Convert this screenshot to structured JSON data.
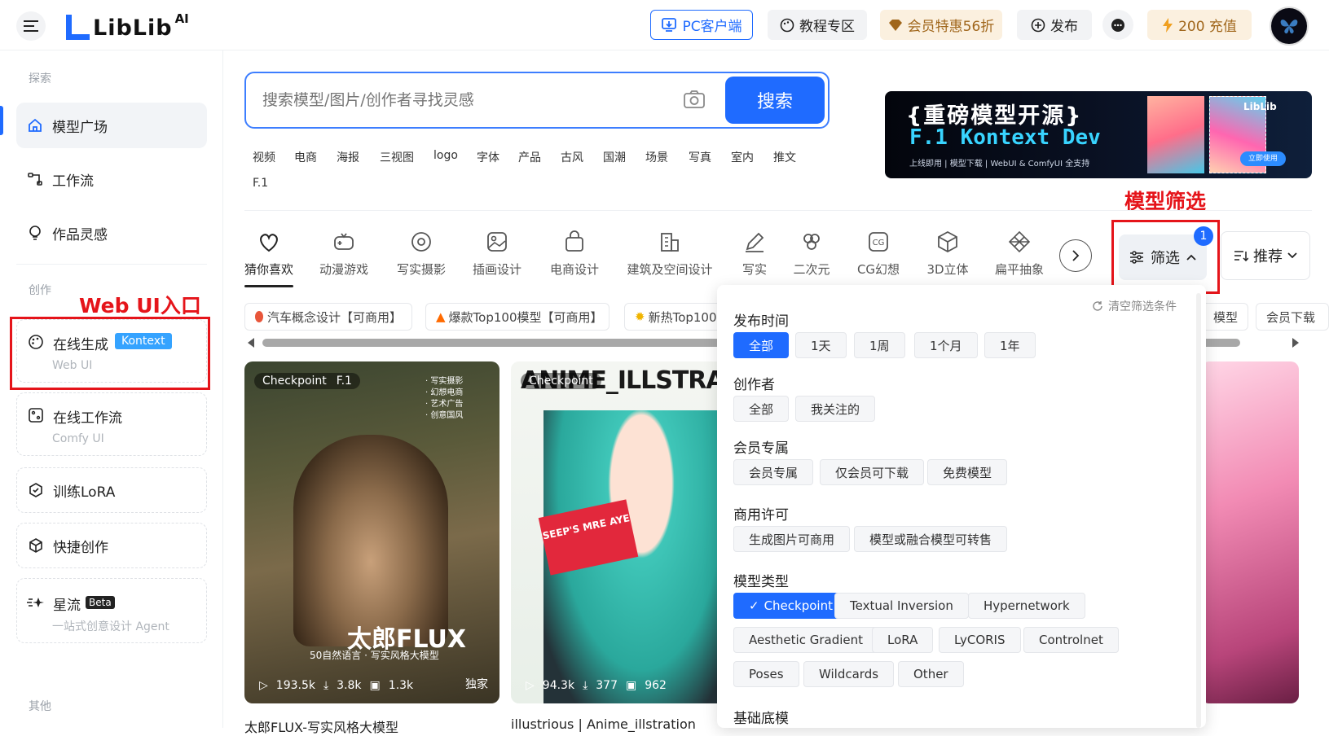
{
  "header": {
    "logo_text": "LibLib",
    "logo_ai": "AI",
    "pc_client": "PC客户端",
    "tutorials": "教程专区",
    "membership": "会员特惠56折",
    "publish": "发布",
    "points": "200 充值",
    "accent": "#1f6bff"
  },
  "sidebar": {
    "explore_label": "探索",
    "model_square": "模型广场",
    "workflow": "工作流",
    "inspiration": "作品灵感",
    "create_label": "创作",
    "online_gen": "在线生成",
    "online_gen_badge": "Kontext",
    "online_gen_sub": "Web UI",
    "online_workflow": "在线工作流",
    "online_workflow_sub": "Comfy UI",
    "train_lora": "训练LoRA",
    "quick_create": "快捷创作",
    "star_flow": "星流",
    "star_flow_badge": "Beta",
    "star_flow_sub": "一站式创意设计 Agent",
    "other_label": "其他"
  },
  "search": {
    "placeholder": "搜索模型/图片/创作者寻找灵感",
    "button": "搜索",
    "tags": [
      "视频",
      "电商",
      "海报",
      "三视图",
      "logo",
      "字体",
      "产品",
      "古风",
      "国潮",
      "场景",
      "写真",
      "室内",
      "推文",
      "F.1"
    ]
  },
  "banner": {
    "line1": "{重磅模型开源}",
    "line2": "F.1 Kontext Dev",
    "line3": "上线即用 | 模型下载 | WebUI & ComfyUI 全支持",
    "brand": "LibLib",
    "button": "立即使用"
  },
  "categories": [
    "猜你喜欢",
    "动漫游戏",
    "写实摄影",
    "插画设计",
    "电商设计",
    "建筑及空间设计",
    "写实",
    "二次元",
    "CG幻想",
    "3D立体",
    "扁平抽象"
  ],
  "sort": {
    "filter_label": "筛选",
    "filter_count": "1",
    "recommend_label": "推荐"
  },
  "pills": [
    "汽车概念设计【可商用】",
    "爆款Top100模型【可商用】",
    "新热Top100",
    "模型",
    "会员下载"
  ],
  "annotations": {
    "web_ui": "Web UI入口",
    "model_filter": "模型筛选"
  },
  "filter_panel": {
    "clear": "清空筛选条件",
    "publish_time": {
      "title": "发布时间",
      "options": [
        "全部",
        "1天",
        "1周",
        "1个月",
        "1年"
      ],
      "selected": "全部"
    },
    "creator": {
      "title": "创作者",
      "options": [
        "全部",
        "我关注的"
      ]
    },
    "member": {
      "title": "会员专属",
      "options": [
        "会员专属",
        "仅会员可下载",
        "免费模型"
      ]
    },
    "license": {
      "title": "商用许可",
      "options": [
        "生成图片可商用",
        "模型或融合模型可转售"
      ]
    },
    "model_type": {
      "title": "模型类型",
      "options": [
        "Checkpoint",
        "Textual Inversion",
        "Hypernetwork",
        "Aesthetic Gradient",
        "LoRA",
        "LyCORIS",
        "Controlnet",
        "Poses",
        "Wildcards",
        "Other"
      ],
      "selected": "Checkpoint"
    },
    "base_model": {
      "title": "基础底模"
    }
  },
  "cards": [
    {
      "type": "Checkpoint",
      "base": "F.1",
      "views": "193.5k",
      "downloads": "3.8k",
      "likes": "1.3k",
      "exclusive": "独家",
      "title": "太郎FLUX-写实风格大模型",
      "art_title": "太郎FLUX",
      "art_sub": "50自然语言 · 写实风格大模型",
      "tags": [
        "· 写实摄影",
        "· 幻想电商",
        "· 艺术广告",
        "· 创意国风"
      ]
    },
    {
      "type": "Checkpoint",
      "views": "94.3k",
      "downloads": "377",
      "likes": "962",
      "title": "illustrious | Anime_illstration",
      "art_title": "ANIME_ILLSTRAT",
      "sign": "SEEP'S MRE AYE"
    }
  ]
}
